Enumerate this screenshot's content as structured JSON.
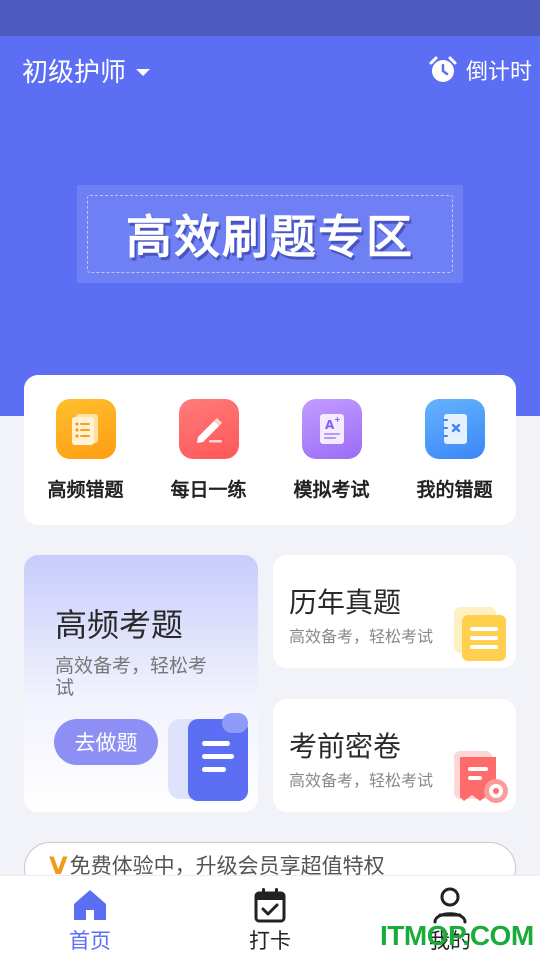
{
  "header": {
    "exam_name": "初级护师",
    "countdown_label": "倒计时"
  },
  "banner": {
    "title": "高效刷题专区"
  },
  "quick_actions": [
    {
      "label": "高频错题",
      "icon": "list-doc-icon",
      "color": "#ffa91f"
    },
    {
      "label": "每日一练",
      "icon": "pencil-icon",
      "color": "#ff6464"
    },
    {
      "label": "模拟考试",
      "icon": "exam-paper-icon",
      "color": "#a77ef8"
    },
    {
      "label": "我的错题",
      "icon": "notebook-icon",
      "color": "#4a97fa"
    }
  ],
  "feature_main": {
    "title": "高频考题",
    "subtitle": "高效备考，轻松考试",
    "button_label": "去做题"
  },
  "feature_cards": [
    {
      "title": "历年真题",
      "subtitle": "高效备考，轻松考试"
    },
    {
      "title": "考前密卷",
      "subtitle": "高效备考，轻松考试"
    }
  ],
  "vip": {
    "badge": "V",
    "text": "免费体验中，升级会员享超值特权"
  },
  "tabbar": {
    "home": "首页",
    "checkin": "打卡",
    "mine": "我的"
  },
  "watermark": "ITMOP.COM",
  "colors": {
    "primary": "#5c6ef3",
    "status_bar": "#4c5bbd",
    "vip_accent": "#f29a1c",
    "watermark": "#1aab3a"
  }
}
